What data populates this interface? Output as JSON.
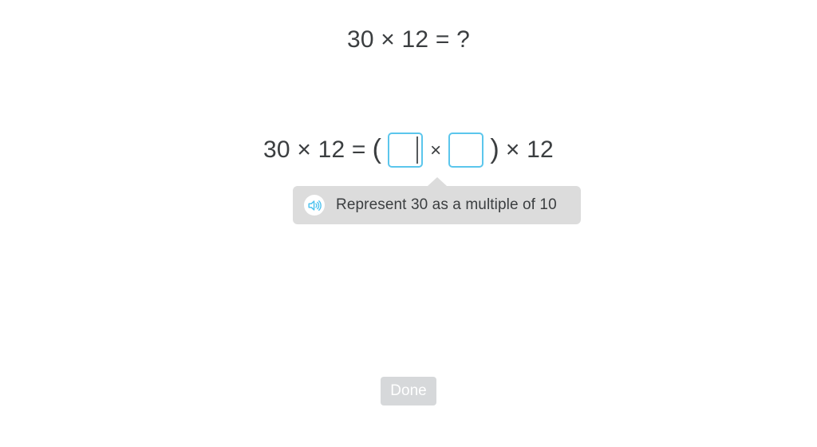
{
  "problem": {
    "title": "30 × 12 = ?"
  },
  "equation": {
    "lhs": "30 × 12 =",
    "left_paren": "(",
    "inner_operator": "×",
    "right_paren": ")",
    "trailing": "× 12",
    "input_1": {
      "value": "",
      "focused": true
    },
    "input_2": {
      "value": "",
      "focused": false
    },
    "border_color": "#5bc6ec",
    "caret_color": "#55595c"
  },
  "hint": {
    "text": "Represent 30 as a multiple of 10",
    "speaker_icon": "speaker-audio-icon",
    "background_color": "#dcdcdc",
    "icon_color": "#4fc3ef"
  },
  "footer": {
    "done_label": "Done",
    "done_disabled": true,
    "done_background": "#d6d8da",
    "done_text_color": "#ffffff"
  }
}
